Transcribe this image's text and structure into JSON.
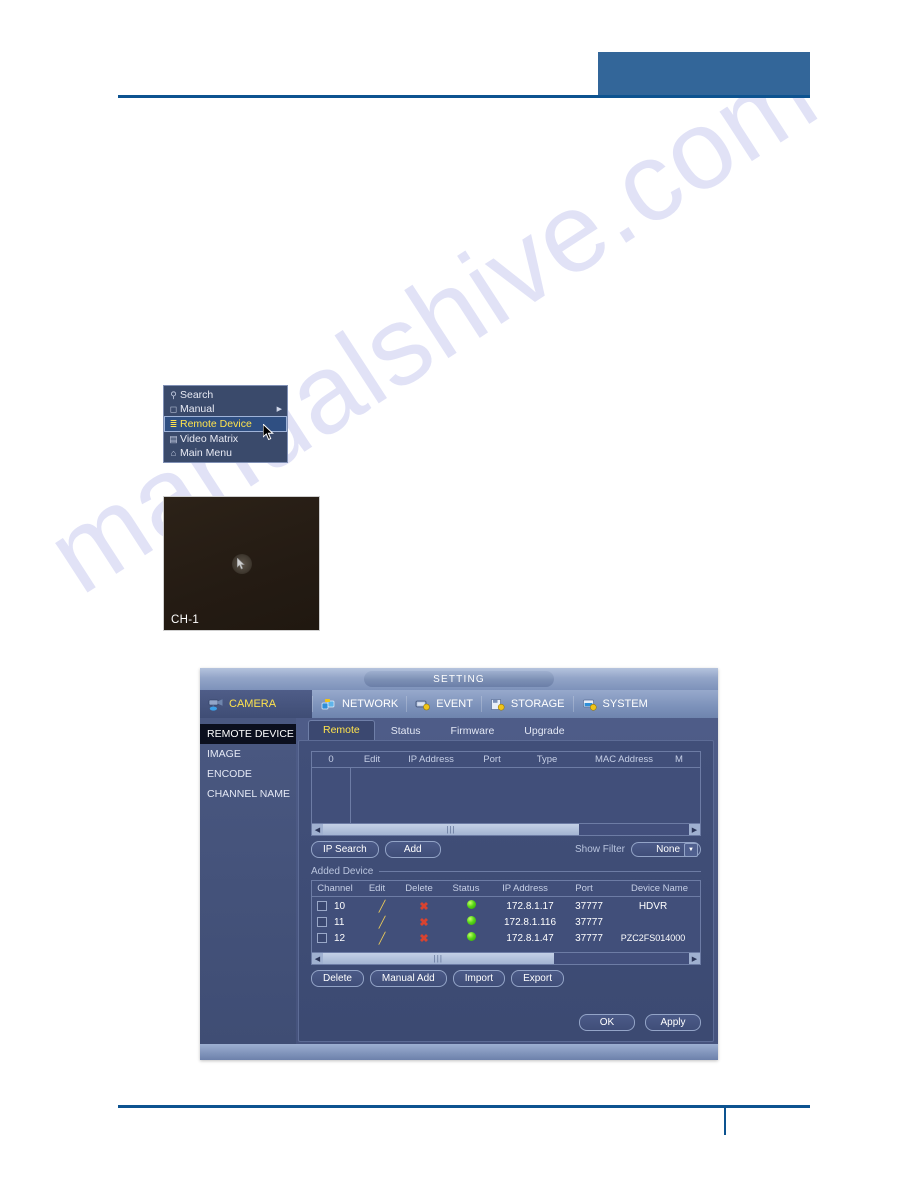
{
  "watermark": {
    "text": "manualshive.com"
  },
  "context_menu": {
    "items": [
      {
        "label": "Search",
        "icon": "magnifier-icon",
        "selected": false,
        "submenu": false
      },
      {
        "label": "Manual",
        "icon": "mouse-icon",
        "selected": false,
        "submenu": true
      },
      {
        "label": "Remote Device",
        "icon": "network-icon",
        "selected": true,
        "submenu": false
      },
      {
        "label": "Video Matrix",
        "icon": "grid-icon",
        "selected": false,
        "submenu": false
      },
      {
        "label": "Main Menu",
        "icon": "home-icon",
        "selected": false,
        "submenu": false
      }
    ]
  },
  "preview": {
    "channel_label": "CH-1"
  },
  "dialog": {
    "title": "SETTING",
    "nav": [
      {
        "label": "CAMERA",
        "icon": "camera-icon",
        "active": true
      },
      {
        "label": "NETWORK",
        "icon": "network-icon",
        "active": false
      },
      {
        "label": "EVENT",
        "icon": "event-icon",
        "active": false
      },
      {
        "label": "STORAGE",
        "icon": "storage-icon",
        "active": false
      },
      {
        "label": "SYSTEM",
        "icon": "system-icon",
        "active": false
      }
    ],
    "sidebar": [
      {
        "label": "REMOTE DEVICE",
        "active": true
      },
      {
        "label": "IMAGE",
        "active": false
      },
      {
        "label": "ENCODE",
        "active": false
      },
      {
        "label": "CHANNEL NAME",
        "active": false
      }
    ],
    "tabs": [
      {
        "label": "Remote",
        "active": true
      },
      {
        "label": "Status",
        "active": false
      },
      {
        "label": "Firmware",
        "active": false
      },
      {
        "label": "Upgrade",
        "active": false
      }
    ],
    "search_table": {
      "columns": [
        "0",
        "Edit",
        "IP Address",
        "Port",
        "Type",
        "MAC Address",
        "M"
      ],
      "rows": []
    },
    "search_buttons": [
      {
        "label": "IP Search"
      },
      {
        "label": "Add"
      }
    ],
    "filter": {
      "label": "Show Filter",
      "value": "None",
      "options": [
        "None"
      ]
    },
    "added_device": {
      "group_label": "Added Device",
      "columns": [
        "Channel",
        "Edit",
        "Delete",
        "Status",
        "IP Address",
        "Port",
        "Device Name"
      ],
      "rows": [
        {
          "channel": "10",
          "edit": "pencil-icon",
          "delete": "x-icon",
          "status": "online",
          "ip": "172.8.1.17",
          "port": "37777",
          "device_name": "HDVR"
        },
        {
          "channel": "11",
          "edit": "pencil-icon",
          "delete": "x-icon",
          "status": "online",
          "ip": "172.8.1.116",
          "port": "37777",
          "device_name": ""
        },
        {
          "channel": "12",
          "edit": "pencil-icon",
          "delete": "x-icon",
          "status": "online",
          "ip": "172.8.1.47",
          "port": "37777",
          "device_name": "PZC2FS014000"
        }
      ]
    },
    "added_buttons": [
      {
        "label": "Delete"
      },
      {
        "label": "Manual Add"
      },
      {
        "label": "Import"
      },
      {
        "label": "Export"
      }
    ],
    "footer_buttons": [
      {
        "label": "OK"
      },
      {
        "label": "Apply"
      }
    ]
  },
  "colors": {
    "accent_blue": "#336699",
    "rule_blue": "#0d5390",
    "highlight_yellow": "#ffe44d",
    "status_green": "#57d718",
    "delete_red": "#d9432f",
    "edit_yellow": "#e8c95a"
  }
}
